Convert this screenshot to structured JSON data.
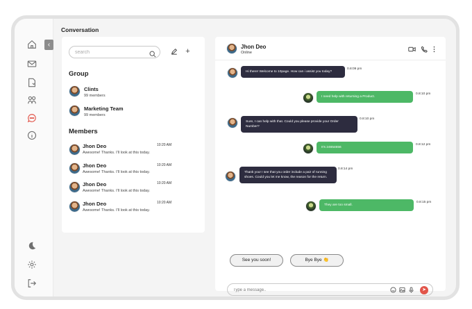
{
  "page": {
    "title": "Conversation"
  },
  "rail": {
    "icons": [
      "home-icon",
      "mail-icon",
      "document-icon",
      "team-icon",
      "chat-icon",
      "info-icon",
      "moon-icon",
      "settings-icon",
      "logout-icon"
    ],
    "active_color": "#e2554a"
  },
  "left_panel": {
    "search_placeholder": "search",
    "groups_heading": "Group",
    "groups": [
      {
        "name": "Clints",
        "sub": "99 members"
      },
      {
        "name": "Marketing Team",
        "sub": "99 members"
      }
    ],
    "members_heading": "Members",
    "members": [
      {
        "name": "Jhon Deo",
        "preview": "Awesome! Thanks. I'll look at this today.",
        "time": "10:20 AM"
      },
      {
        "name": "Jhon Deo",
        "preview": "Awesome! Thanks. I'll look at this today.",
        "time": "10:20 AM"
      },
      {
        "name": "Jhon Deo",
        "preview": "Awesome! Thanks. I'll look at this today.",
        "time": "10:20 AM"
      },
      {
        "name": "Jhon Deo",
        "preview": "Awesome! Thanks. I'll look at this today.",
        "time": "10:20 AM"
      }
    ]
  },
  "chat": {
    "contact_name": "Jhon Deo",
    "contact_status": "Online",
    "messages": [
      {
        "side": "in",
        "text": "Hi there! Welcome to 10page. How can i assist you today?",
        "time": "0.8:09 pm"
      },
      {
        "side": "out",
        "text": "I need help with returning a Product.",
        "time": "0.8:10 pm"
      },
      {
        "side": "in",
        "text": "Sure, I can help with that. Could you please provide your Order Number?",
        "time": "0.8:10 pm"
      },
      {
        "side": "out",
        "text": "It's 24654656",
        "time": "0.8:12 pm"
      },
      {
        "side": "in",
        "text": "Thank you! I see that you order include a pair of running shoes. Could you let me know, the reason for the return.",
        "time": "0.8:14 pm"
      },
      {
        "side": "out",
        "text": "They are too small.",
        "time": "0.8:15 pm"
      }
    ],
    "quick_replies": [
      "See  you soon!",
      "Bye Bye 👏"
    ],
    "composer_placeholder": "Type a message..",
    "accent_green": "#4db866",
    "accent_dark": "#2d2c3f"
  }
}
